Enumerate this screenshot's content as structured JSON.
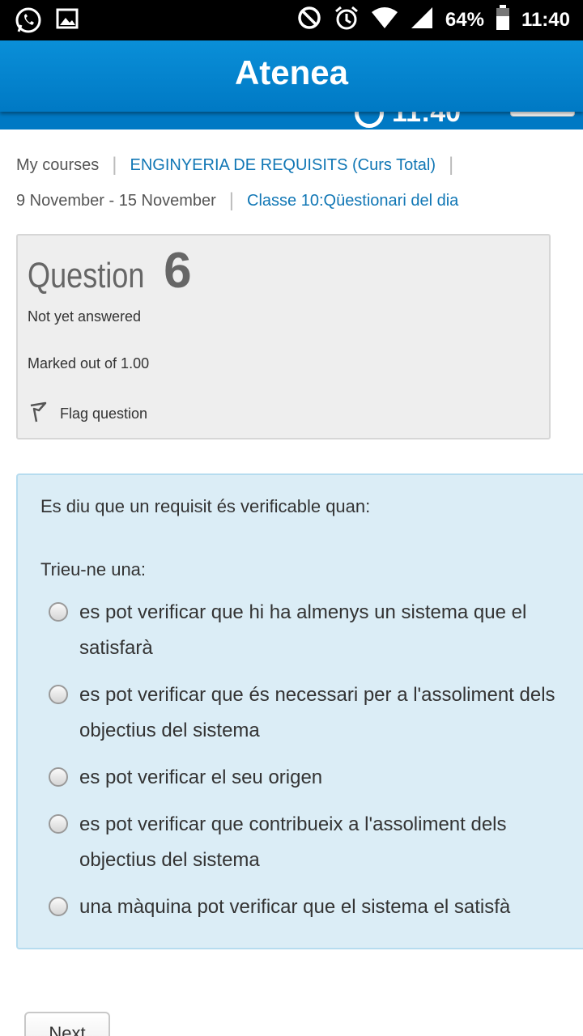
{
  "status_bar": {
    "icons_left": [
      "whatsapp-icon",
      "image-icon"
    ],
    "icons_right": [
      "do-not-disturb-icon",
      "alarm-icon",
      "wifi-icon",
      "signal-icon",
      "battery-icon"
    ],
    "battery_percent": "64%",
    "time": "11:40"
  },
  "app_bar": {
    "title": "Atenea"
  },
  "timer": {
    "time": "11:40"
  },
  "breadcrumb": {
    "items": [
      {
        "label": "My courses"
      },
      {
        "label": "ENGINYERIA DE REQUISITS (Curs Total)"
      },
      {
        "label": "9 November - 15 November"
      },
      {
        "label": "Classe 10:Qüestionari del dia"
      }
    ]
  },
  "question_info": {
    "word": "Question",
    "number": "6",
    "state": "Not yet answered",
    "grade": "Marked out of 1.00",
    "flag_label": "Flag question"
  },
  "question": {
    "text": "Es diu que un requisit és verificable quan:",
    "prompt": "Trieu-ne una:",
    "answers": [
      {
        "label": "es pot verificar que hi ha almenys un sistema que el satisfarà"
      },
      {
        "label": "es pot verificar que és necessari per a l'assoliment dels objectius del sistema"
      },
      {
        "label": "es pot verificar el seu origen"
      },
      {
        "label": "es pot verificar que contribueix a l'assoliment dels objectius del sistema"
      },
      {
        "label": "una màquina pot verificar que el sistema el satisfà"
      }
    ]
  },
  "navigation": {
    "next_label": "Next"
  },
  "colors": {
    "app_bar": "#0a8fd8",
    "link": "#1177b5",
    "question_bg": "#dbedf6",
    "info_bg": "#eeeeee"
  }
}
